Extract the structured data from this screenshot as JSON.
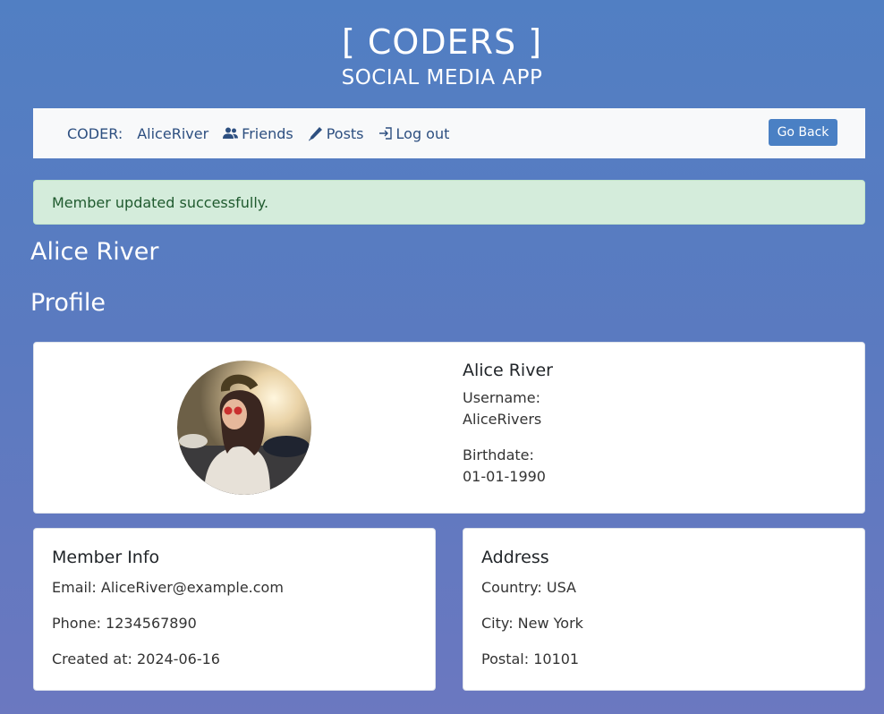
{
  "header": {
    "title": "[ CODERS ]",
    "subtitle": "SOCIAL MEDIA APP"
  },
  "nav": {
    "coder_label": "CODER:",
    "username": "AliceRiver",
    "friends": "Friends",
    "posts": "Posts",
    "logout": "Log out",
    "go_back": "Go Back"
  },
  "alert": {
    "message": "Member updated successfully."
  },
  "page": {
    "name_heading": "Alice River",
    "profile_heading": "Profile"
  },
  "profile": {
    "name": "Alice River",
    "username_label": "Username:",
    "username": "AliceRivers",
    "birthdate_label": "Birthdate:",
    "birthdate": "01-01-1990"
  },
  "member_info": {
    "title": "Member Info",
    "email": "Email: AliceRiver@example.com",
    "phone": "Phone: 1234567890",
    "created": "Created at: 2024-06-16"
  },
  "address": {
    "title": "Address",
    "country": "Country: USA",
    "city": "City: New York",
    "postal": "Postal: 10101"
  },
  "colors": {
    "accent": "#4a80c4",
    "nav_text": "#2d4f80",
    "alert_bg": "#d4ecdb"
  },
  "icons": {
    "friends": "users-icon",
    "posts": "pencil-icon",
    "logout": "login-arrow-icon"
  }
}
